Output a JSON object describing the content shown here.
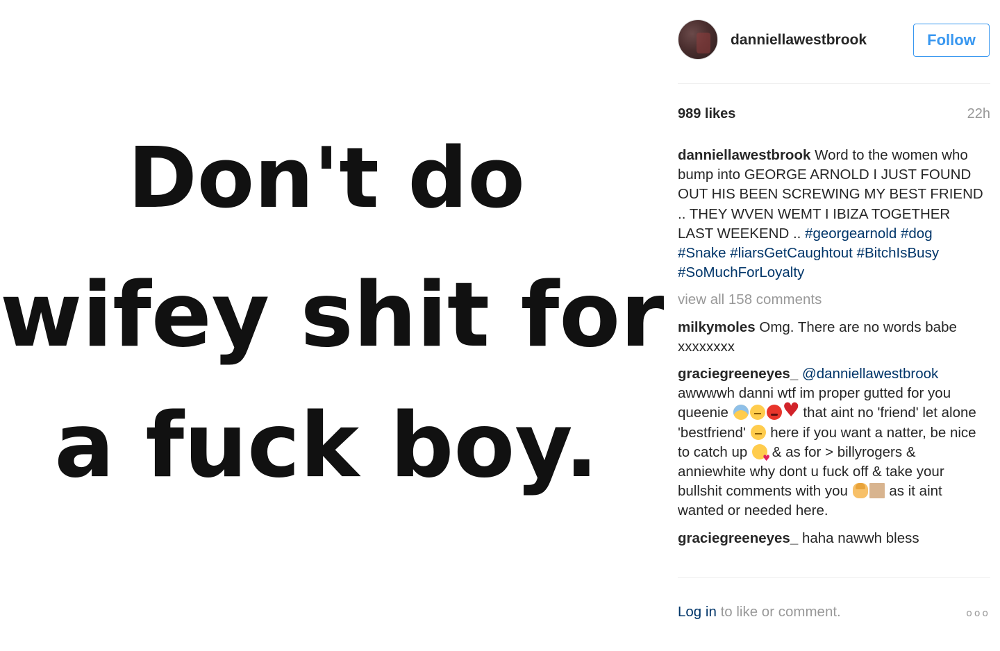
{
  "post": {
    "image_quote": {
      "line1": "Don't do",
      "line2": "wifey shit for",
      "line3": "a fuck boy."
    }
  },
  "header": {
    "username": "danniellawestbrook",
    "follow_label": "Follow",
    "accent_color": "#3897f0"
  },
  "stats": {
    "likes": "989 likes",
    "time": "22h"
  },
  "caption": {
    "user": "danniellawestbrook",
    "text": "Word to the women who bump into GEORGE ARNOLD I JUST FOUND OUT HIS BEEN SCREWING MY BEST FRIEND .. THEY WVEN WEMT I IBIZA TOGETHER LAST WEEKEND ..",
    "hashtags": [
      "#georgearnold",
      "#dog",
      "#Snake",
      "#liarsGetCaughtout",
      "#BitchIsBusy",
      "#SoMuchForLoyalty"
    ]
  },
  "view_all_comments": "view all 158 comments",
  "comments": [
    {
      "user": "milkymoles",
      "text": "Omg. There are no words babe xxxxxxxx"
    },
    {
      "user": "graciegreeneyes_",
      "mention": "@danniellawestbrook",
      "part1": "awwwwh danni wtf im proper gutted for you queenie",
      "part2": "that aint no 'friend' let alone 'bestfriend'",
      "part3": "here if you want a natter, be nice to catch up",
      "part4": "& as for > billyrogers & anniewhite why dont u fuck off & take your bullshit comments with you",
      "part5": "as it aint wanted or needed here."
    },
    {
      "user": "graciegreeneyes_",
      "text": "haha nawwh bless"
    }
  ],
  "footer": {
    "login_label": "Log in",
    "rest_label": "to like or comment.",
    "more_icon": "ooo"
  }
}
